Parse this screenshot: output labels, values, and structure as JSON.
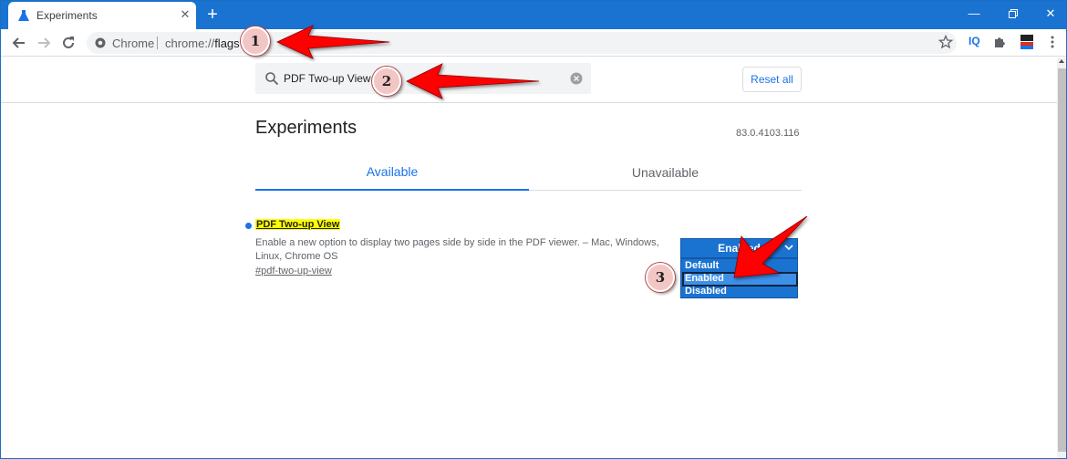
{
  "browser": {
    "tab_title": "Experiments",
    "new_tab_icon": "plus-icon",
    "omnibox": {
      "scheme_label": "Chrome",
      "url_prefix": "chrome://",
      "url_host": "flags"
    },
    "extensions": {
      "iq_label": "IQ"
    }
  },
  "flags_page": {
    "search": {
      "value": "PDF Two-up View"
    },
    "reset_label": "Reset all",
    "title": "Experiments",
    "version": "83.0.4103.116",
    "tabs": [
      {
        "label": "Available",
        "selected": true
      },
      {
        "label": "Unavailable",
        "selected": false
      }
    ],
    "flag": {
      "name": "PDF Two-up View",
      "description": "Enable a new option to display two pages side by side in the PDF viewer. – Mac, Windows, Linux, Chrome OS",
      "anchor": "#pdf-two-up-view",
      "selected_value": "Enabled",
      "options": [
        "Default",
        "Enabled",
        "Disabled"
      ]
    }
  },
  "annotations": {
    "step1": "1",
    "step2": "2",
    "step3": "3",
    "arrow_color": "#ff0000"
  },
  "colors": {
    "accent": "#1a73e8",
    "titlebar": "#1a73d1",
    "highlight": "#ffff00"
  }
}
